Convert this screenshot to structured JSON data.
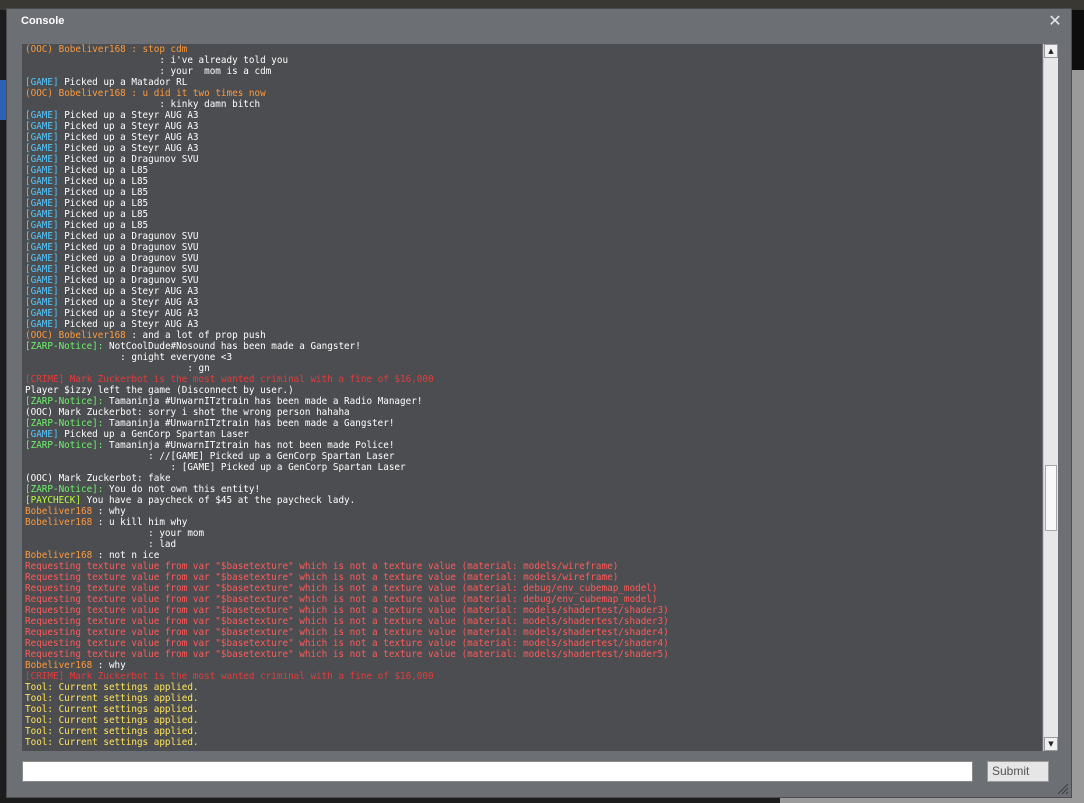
{
  "window": {
    "title": "Console",
    "close_symbol": "✕"
  },
  "colors": {
    "ooc": "#ff9a3c",
    "game": "#55c8ff",
    "zarp": "#6ef26a",
    "crime": "#e83a3a",
    "paycheck": "#b8ff3a",
    "error": "#ff5a5a",
    "tool": "#ffe45a",
    "text": "#ffffff",
    "ghost": "#6a6c70"
  },
  "console": {
    "lines": [
      [
        {
          "t": "(OOC) ",
          "c": "ooc"
        },
        {
          "t": "Bobeliver168 : stop cdm",
          "c": "ooc"
        }
      ],
      [
        {
          "t": "                        : i've already told you",
          "c": "text"
        }
      ],
      [
        {
          "t": "                        : your  mom is a cdm",
          "c": "text"
        }
      ],
      [
        {
          "t": "[GAME] ",
          "c": "game"
        },
        {
          "t": "Picked up a Matador RL",
          "c": "text"
        }
      ],
      [
        {
          "t": "(OOC) ",
          "c": "ooc"
        },
        {
          "t": "Bobeliver168 : u did it two times now",
          "c": "ooc"
        }
      ],
      [
        {
          "t": "                        : kinky damn bitch",
          "c": "text"
        }
      ],
      [
        {
          "t": "[GAME] ",
          "c": "game"
        },
        {
          "t": "Picked up a Steyr AUG A3",
          "c": "text"
        }
      ],
      [
        {
          "t": "[GAME] ",
          "c": "game"
        },
        {
          "t": "Picked up a Steyr AUG A3",
          "c": "text"
        }
      ],
      [
        {
          "t": "[GAME] ",
          "c": "game"
        },
        {
          "t": "Picked up a Steyr AUG A3",
          "c": "text"
        }
      ],
      [
        {
          "t": "[GAME] ",
          "c": "game"
        },
        {
          "t": "Picked up a Steyr AUG A3",
          "c": "text"
        }
      ],
      [
        {
          "t": "[GAME] ",
          "c": "game"
        },
        {
          "t": "Picked up a Dragunov SVU",
          "c": "text"
        }
      ],
      [
        {
          "t": "[GAME] ",
          "c": "game"
        },
        {
          "t": "Picked up a L85",
          "c": "text"
        }
      ],
      [
        {
          "t": "[GAME] ",
          "c": "game"
        },
        {
          "t": "Picked up a L85",
          "c": "text"
        }
      ],
      [
        {
          "t": "[GAME] ",
          "c": "game"
        },
        {
          "t": "Picked up a L85",
          "c": "text"
        }
      ],
      [
        {
          "t": "[GAME] ",
          "c": "game"
        },
        {
          "t": "Picked up a L85",
          "c": "text"
        }
      ],
      [
        {
          "t": "[GAME] ",
          "c": "game"
        },
        {
          "t": "Picked up a L85",
          "c": "text"
        }
      ],
      [
        {
          "t": "[GAME] ",
          "c": "game"
        },
        {
          "t": "Picked up a L85",
          "c": "text"
        }
      ],
      [
        {
          "t": "[GAME] ",
          "c": "game"
        },
        {
          "t": "Picked up a Dragunov SVU",
          "c": "text"
        }
      ],
      [
        {
          "t": "[GAME] ",
          "c": "game"
        },
        {
          "t": "Picked up a Dragunov SVU",
          "c": "text"
        }
      ],
      [
        {
          "t": "[GAME] ",
          "c": "game"
        },
        {
          "t": "Picked up a Dragunov SVU",
          "c": "text"
        }
      ],
      [
        {
          "t": "[GAME] ",
          "c": "game"
        },
        {
          "t": "Picked up a Dragunov SVU",
          "c": "text"
        }
      ],
      [
        {
          "t": "[GAME] ",
          "c": "game"
        },
        {
          "t": "Picked up a Dragunov SVU",
          "c": "text"
        }
      ],
      [
        {
          "t": "[GAME] ",
          "c": "game"
        },
        {
          "t": "Picked up a Steyr AUG A3",
          "c": "text"
        }
      ],
      [
        {
          "t": "[GAME] ",
          "c": "game"
        },
        {
          "t": "Picked up a Steyr AUG A3",
          "c": "text"
        }
      ],
      [
        {
          "t": "[GAME] ",
          "c": "game"
        },
        {
          "t": "Picked up a Steyr AUG A3",
          "c": "text"
        }
      ],
      [
        {
          "t": "[GAME] ",
          "c": "game"
        },
        {
          "t": "Picked up a Steyr AUG A3",
          "c": "text"
        }
      ],
      [
        {
          "t": "(OOC) ",
          "c": "ooc"
        },
        {
          "t": "Bobeliver168 ",
          "c": "ooc"
        },
        {
          "t": ": and a lot of prop push",
          "c": "text"
        }
      ],
      [
        {
          "t": "[ZARP-Notice]: ",
          "c": "zarp"
        },
        {
          "t": "NotCoolDude#Nosound has been made a Gangster!",
          "c": "text"
        }
      ],
      [
        {
          "t": "                 : gnight everyone <3",
          "c": "text"
        }
      ],
      [
        {
          "t": "                             : gn",
          "c": "text"
        }
      ],
      [
        {
          "t": "[CRIME] Mark Zuckerbot is the most wanted criminal with a fine of $16,000",
          "c": "crime"
        }
      ],
      [
        {
          "t": "Player $izzy left the game (Disconnect by user.)",
          "c": "text"
        }
      ],
      [
        {
          "t": "[ZARP-Notice]: ",
          "c": "zarp"
        },
        {
          "t": "Tamaninja #UnwarnITztrain has been made a Radio Manager!",
          "c": "text"
        }
      ],
      [
        {
          "t": "(OOC) Mark Zuckerbot",
          "c": "text"
        },
        {
          "t": ": sorry i shot the wrong person hahaha",
          "c": "text"
        }
      ],
      [
        {
          "t": "[ZARP-Notice]: ",
          "c": "zarp"
        },
        {
          "t": "Tamaninja #UnwarnITztrain has been made a Gangster!",
          "c": "text"
        }
      ],
      [
        {
          "t": "[GAME] ",
          "c": "game"
        },
        {
          "t": "Picked up a GenCorp Spartan Laser",
          "c": "text"
        }
      ],
      [
        {
          "t": "[ZARP-Notice]: ",
          "c": "zarp"
        },
        {
          "t": "Tamaninja #UnwarnITztrain has not been made Police!",
          "c": "text"
        }
      ],
      [
        {
          "t": "                      : //[GAME] Picked up a GenCorp Spartan Laser",
          "c": "text"
        }
      ],
      [
        {
          "t": "                          : [GAME] Picked up a GenCorp Spartan Laser",
          "c": "text"
        }
      ],
      [
        {
          "t": "(OOC) Mark Zuckerbot",
          "c": "text"
        },
        {
          "t": ": fake",
          "c": "text"
        }
      ],
      [
        {
          "t": "[ZARP-Notice]: ",
          "c": "zarp"
        },
        {
          "t": "You do not own this entity!",
          "c": "text"
        }
      ],
      [
        {
          "t": "[PAYCHECK] ",
          "c": "paycheck"
        },
        {
          "t": "You have a paycheck of $45 at the paycheck lady.",
          "c": "text"
        }
      ],
      [
        {
          "t": "Bobeliver168 ",
          "c": "ooc"
        },
        {
          "t": ": why",
          "c": "text"
        }
      ],
      [
        {
          "t": "Bobeliver168 ",
          "c": "ooc"
        },
        {
          "t": ": u kill him why",
          "c": "text"
        }
      ],
      [
        {
          "t": "                      : your mom",
          "c": "text"
        }
      ],
      [
        {
          "t": "                      : lad",
          "c": "text"
        }
      ],
      [
        {
          "t": "Bobeliver168 ",
          "c": "ooc"
        },
        {
          "t": ": not n ice",
          "c": "text"
        }
      ],
      [
        {
          "t": "Requesting texture value from var \"$basetexture\" which is not a texture value (material: models/wireframe)",
          "c": "error"
        }
      ],
      [
        {
          "t": "Requesting texture value from var \"$basetexture\" which is not a texture value (material: models/wireframe)",
          "c": "error"
        }
      ],
      [
        {
          "t": "Requesting texture value from var \"$basetexture\" which is not a texture value (material: debug/env_cubemap_model)",
          "c": "error"
        }
      ],
      [
        {
          "t": "Requesting texture value from var \"$basetexture\" which is not a texture value (material: debug/env_cubemap_model)",
          "c": "error"
        }
      ],
      [
        {
          "t": "Requesting texture value from var \"$basetexture\" which is not a texture value (material: models/shadertest/shader3)",
          "c": "error"
        }
      ],
      [
        {
          "t": "Requesting texture value from var \"$basetexture\" which is not a texture value (material: models/shadertest/shader3)",
          "c": "error"
        }
      ],
      [
        {
          "t": "Requesting texture value from var \"$basetexture\" which is not a texture value (material: models/shadertest/shader4)",
          "c": "error"
        }
      ],
      [
        {
          "t": "Requesting texture value from var \"$basetexture\" which is not a texture value (material: models/shadertest/shader4)",
          "c": "error"
        }
      ],
      [
        {
          "t": "Requesting texture value from var \"$basetexture\" which is not a texture value (material: models/shadertest/shader5)",
          "c": "error"
        }
      ],
      [
        {
          "t": "Bobeliver168 ",
          "c": "ooc"
        },
        {
          "t": ": why",
          "c": "text"
        }
      ],
      [
        {
          "t": "[CRIME] Mark Zuckerbot is the most wanted criminal with a fine of $16,000",
          "c": "crime"
        }
      ],
      [
        {
          "t": "Tool: Current settings applied.",
          "c": "tool"
        }
      ],
      [
        {
          "t": "Tool: Current settings applied.",
          "c": "tool"
        }
      ],
      [
        {
          "t": "Tool: Current settings applied.",
          "c": "tool"
        }
      ],
      [
        {
          "t": "Tool: Current settings applied.",
          "c": "tool"
        }
      ],
      [
        {
          "t": "Tool: Current settings applied.",
          "c": "tool"
        }
      ],
      [
        {
          "t": "Tool: Current settings applied.",
          "c": "tool"
        }
      ]
    ]
  },
  "scrollbar": {
    "up_symbol": "▲",
    "down_symbol": "▼"
  },
  "input": {
    "value": "",
    "placeholder": ""
  },
  "submit_label": "Submit"
}
